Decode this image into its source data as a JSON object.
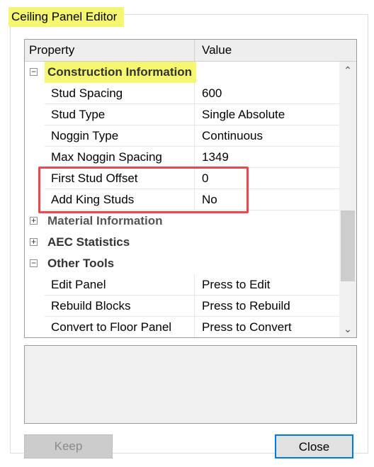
{
  "window": {
    "title": "Ceiling Panel Editor"
  },
  "grid": {
    "headers": {
      "property": "Property",
      "value": "Value"
    },
    "categories": {
      "construction": {
        "label": "Construction Information",
        "expander": "−",
        "rows": [
          {
            "property": "Stud Spacing",
            "value": "600"
          },
          {
            "property": "Stud Type",
            "value": "Single Absolute"
          },
          {
            "property": "Noggin Type",
            "value": "Continuous"
          },
          {
            "property": "Max Noggin Spacing",
            "value": "1349"
          },
          {
            "property": "First Stud Offset",
            "value": "0"
          },
          {
            "property": "Add King Studs",
            "value": "No"
          }
        ]
      },
      "material": {
        "label": "Material Information",
        "expander": "+"
      },
      "aec": {
        "label": "AEC Statistics",
        "expander": "+"
      },
      "other": {
        "label": "Other Tools",
        "expander": "−",
        "rows": [
          {
            "property": "Edit Panel",
            "value": "Press to Edit"
          },
          {
            "property": "Rebuild Blocks",
            "value": "Press to Rebuild"
          },
          {
            "property": "Convert to Floor Panel",
            "value": "Press to Convert"
          }
        ]
      }
    },
    "scrollbar": {
      "up_icon": "⌃",
      "down_icon": "⌄"
    }
  },
  "buttons": {
    "keep": "Keep",
    "close": "Close"
  },
  "colors": {
    "highlight": "#f6f770",
    "annotation_box": "#e8494f",
    "focus_border": "#0078d7"
  }
}
